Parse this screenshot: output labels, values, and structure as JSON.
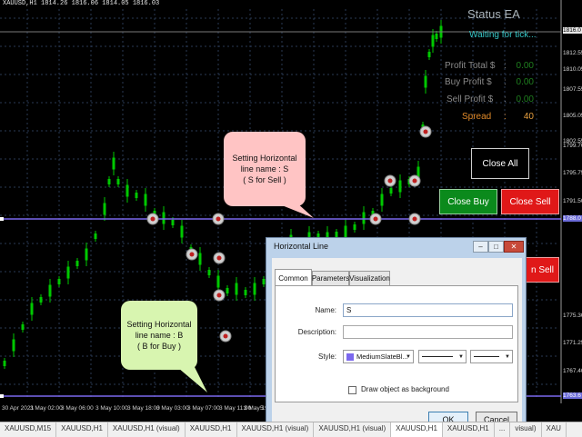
{
  "chart_header": "XAUUSD,H1  1814.26 1816.06 1814.05 1816.03",
  "ea_panel": {
    "title": "Status EA",
    "status": "Waiting for tick...",
    "profit_total_label": "Profit Total $",
    "profit_total_sep": ":",
    "profit_total_value": "0.00",
    "buy_profit_label": "Buy Profit $",
    "buy_profit_sep": ":",
    "buy_profit_value": "0.00",
    "sell_profit_label": "Sell Profit $",
    "sell_profit_sep": ":",
    "sell_profit_value": "0.00",
    "spread_label": "Spread",
    "spread_sep": ":",
    "spread_value": "40",
    "close_all": "Close All",
    "close_buy": "Close Buy",
    "close_sell": "Close Sell",
    "close_sell_partial": "n Sell"
  },
  "price_axis": [
    "1816.0",
    "1812.55",
    "1810.05",
    "1807.55",
    "1805.05",
    "1802.55",
    "1799.70",
    "1795.75",
    "1791.50",
    "1788.0",
    "1775.30",
    "1771.25",
    "1767.40",
    "1763.6"
  ],
  "price_axis_current": "1816.0",
  "price_axis_line": "1788.0",
  "price_axis_low": "1763.6",
  "time_axis": [
    "30 Apr 2021",
    "3 May 02:00",
    "3 May 06:00",
    "3 May 10:00",
    "3 May 18:00",
    "3 May 03:00",
    "3 May 07:00",
    "3 May 11:00",
    "3 May 19:00",
    "5"
  ],
  "callout_sell": {
    "line1": "Setting Horizontal",
    "line2": "line name  : S",
    "line3": "( S for Sell )"
  },
  "callout_buy": {
    "line1": "Setting Horizontal",
    "line2": "line name  : B",
    "line3": "( B for Buy )"
  },
  "dialog": {
    "title": "Horizontal Line",
    "tabs": [
      "Common",
      "Parameters",
      "Visualization"
    ],
    "name_label": "Name:",
    "name_value": "S",
    "description_label": "Description:",
    "description_value": "",
    "style_label": "Style:",
    "color_name": "MediumSlateBl...",
    "draw_background_label": "Draw object as background",
    "ok": "OK",
    "cancel": "Cancel",
    "line_color": "#7b68ee"
  },
  "bottom_tabs": [
    "XAUUSD,M15",
    "XAUUSD,H1",
    "XAUUSD,H1 (visual)",
    "XAUUSD,H1",
    "XAUUSD,H1 (visual)",
    "XAUUSD,H1 (visual)",
    "XAUUSD,H1",
    "XAUUSD,H1",
    "...",
    "visual)",
    "XAU"
  ],
  "colors": {
    "background": "#000000",
    "candle": "#00c800",
    "grid": "#2a3a55",
    "hline": "#7b68ee",
    "close_buy": "#0b8a1c",
    "close_sell": "#e01818"
  }
}
